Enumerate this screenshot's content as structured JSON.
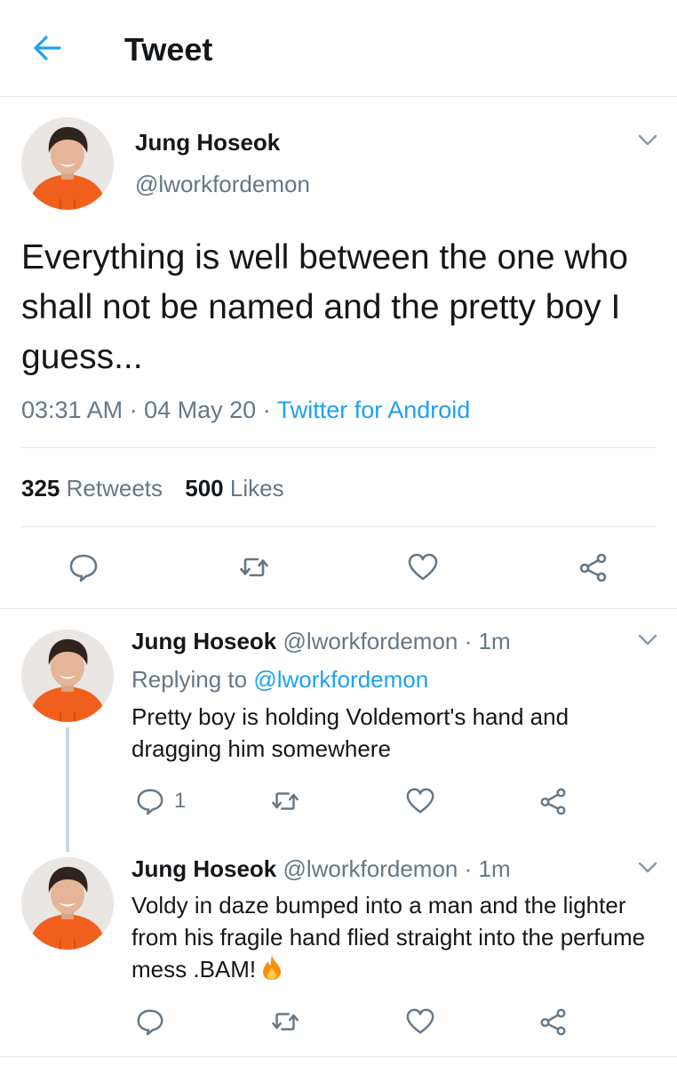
{
  "header": {
    "title": "Tweet",
    "back_icon": "arrow-left-icon",
    "accent": "#1da1f2"
  },
  "main_tweet": {
    "name": "Jung Hoseok",
    "handle": "@lworkfordemon",
    "text": "Everything is well between the one who shall not be named and the pretty boy I guess...",
    "time": "03:31 AM",
    "dot1": "·",
    "date": "04 May 20",
    "dot2": "·",
    "source": "Twitter for Android",
    "retweets_count": "325",
    "retweets_label": "Retweets",
    "likes_count": "500",
    "likes_label": "Likes"
  },
  "replies": [
    {
      "name": "Jung Hoseok",
      "handle": "@lworkfordemon",
      "sep": "·",
      "time": "1m",
      "replying_label": "Replying to",
      "replying_to": "@lworkfordemon",
      "text": "Pretty boy is holding Voldemort's hand and dragging him somewhere",
      "reply_count": "1"
    },
    {
      "name": "Jung Hoseok",
      "handle": "@lworkfordemon",
      "sep": "·",
      "time": "1m",
      "text": "Voldy in daze bumped into a man and the lighter from his fragile hand flied straight into the perfume mess .BAM!",
      "emoji_icon": "fire-emoji-icon"
    }
  ],
  "colors": {
    "text": "#14171a",
    "secondary": "#657786",
    "link": "#1da1f2",
    "divider": "#e1e8ed",
    "thread": "#ccd6dd"
  }
}
